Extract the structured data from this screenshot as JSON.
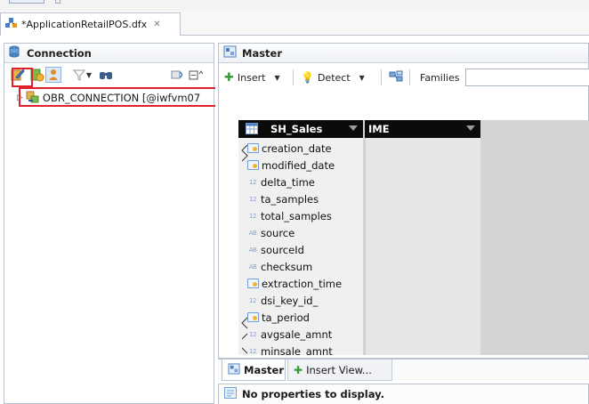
{
  "editor": {
    "tab_title": "*ApplicationRetailPOS.dfx",
    "close_glyph": "✕"
  },
  "connection_panel": {
    "title": "Connection",
    "tree": {
      "expand_glyph": "▷",
      "item_label": "OBR_CONNECTION [@iwfvm07"
    }
  },
  "master_panel": {
    "title": "Master",
    "toolbar": {
      "insert_label": "Insert",
      "detect_label": "Detect",
      "families_label": "Families",
      "families_value": ""
    },
    "table": {
      "table_name": "SH_Sales",
      "second_column_header": "IME",
      "columns": [
        {
          "name": "creation_date",
          "type_icon": "timestamp"
        },
        {
          "name": "modified_date",
          "type_icon": "timestamp"
        },
        {
          "name": "delta_time",
          "type_icon": "numeric",
          "type_text": "12"
        },
        {
          "name": "ta_samples",
          "type_icon": "numeric",
          "type_text": "12"
        },
        {
          "name": "total_samples",
          "type_icon": "numeric",
          "type_text": "12"
        },
        {
          "name": "source",
          "type_icon": "string",
          "type_text": "AB"
        },
        {
          "name": "sourceId",
          "type_icon": "string",
          "type_text": "AB"
        },
        {
          "name": "checksum",
          "type_icon": "string",
          "type_text": "AB"
        },
        {
          "name": "extraction_time",
          "type_icon": "timestamp"
        },
        {
          "name": "dsi_key_id_",
          "type_icon": "numeric",
          "type_text": "12"
        },
        {
          "name": "ta_period",
          "type_icon": "timestamp"
        },
        {
          "name": "avgsale_amnt",
          "type_icon": "numeric",
          "type_text": "12"
        },
        {
          "name": "minsale_amnt",
          "type_icon": "numeric",
          "type_text": "12"
        }
      ]
    },
    "bottom_tabs": {
      "master_label": "Master",
      "insert_view_label": "Insert View..."
    }
  },
  "properties_panel": {
    "message": "No properties to display."
  },
  "colors": {
    "highlight_box": "#e0202a",
    "table_header_bg": "#0b0b0b",
    "panel_border": "#b9c3cf"
  }
}
